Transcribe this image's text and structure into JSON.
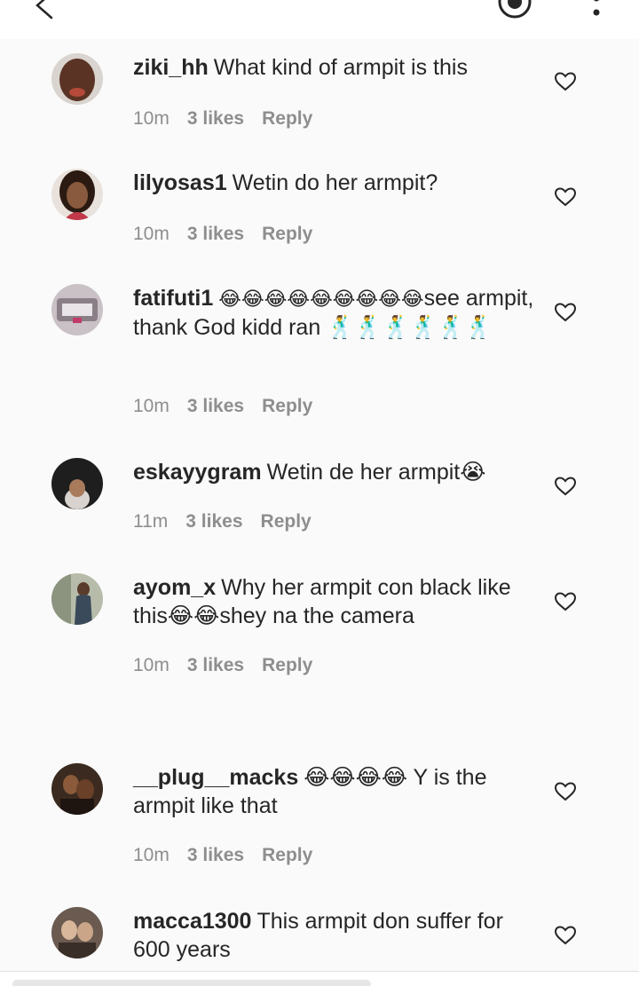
{
  "header": {
    "back_icon": "chevron-left-icon",
    "record_icon": "record-icon",
    "more_icon": "more-vertical-icon"
  },
  "comments": [
    {
      "username": "ziki_hh",
      "text": "What kind of armpit is this",
      "time": "10m",
      "likes": "3 likes",
      "reply": "Reply",
      "avatar_color": "#6b3b2a"
    },
    {
      "username": "lilyosas1",
      "text": "Wetin do her armpit?",
      "time": "10m",
      "likes": "3 likes",
      "reply": "Reply",
      "avatar_color": "#3a2418"
    },
    {
      "username": "fatifuti1",
      "text_before": "😂😂😂😂😂😂😂😂😂",
      "text": "see armpit, thank God kidd ran 🕺🕺🕺🕺🕺🕺",
      "time": "10m",
      "likes": "3 likes",
      "reply": "Reply",
      "avatar_color": "#b9b0b6"
    },
    {
      "username": "eskayygram",
      "text": "Wetin de her armpit😭",
      "time": "11m",
      "likes": "3 likes",
      "reply": "Reply",
      "avatar_color": "#2a2a2a"
    },
    {
      "username": "ayom_x",
      "text": "Why her armpit con black like this😂😂shey na the camera",
      "time": "10m",
      "likes": "3 likes",
      "reply": "Reply",
      "avatar_color": "#9aa08f"
    },
    {
      "username": "__plug__macks",
      "text": "😂😂😂😂 Y is the armpit like that",
      "time": "10m",
      "likes": "3 likes",
      "reply": "Reply",
      "avatar_color": "#4a3222"
    },
    {
      "username": "macca1300",
      "text": "This armpit don suffer for 600 years",
      "avatar_color": "#5b4a40"
    }
  ],
  "colors": {
    "text": "#262626",
    "meta": "#8e8e8e",
    "background": "#fafafa"
  }
}
